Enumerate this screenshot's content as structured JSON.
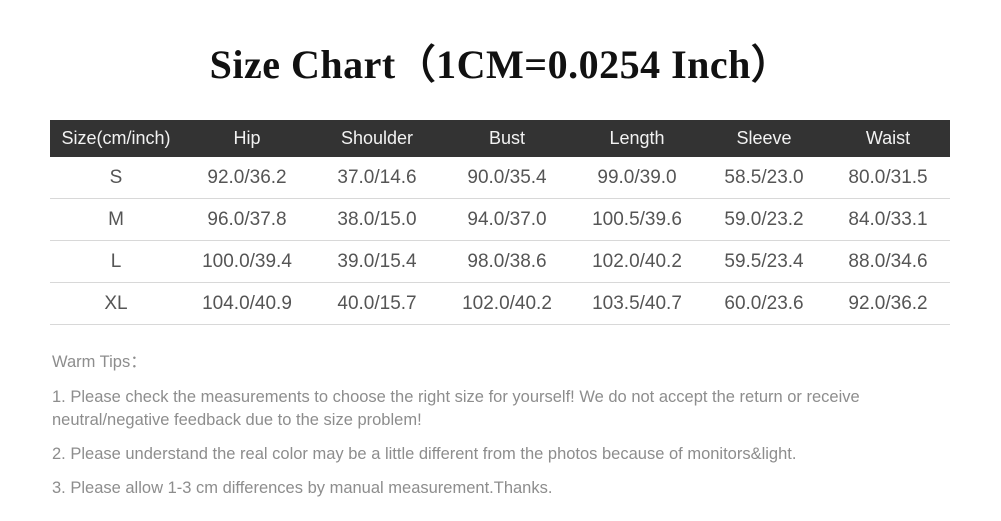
{
  "title": "Size Chart（1CM=0.0254 Inch）",
  "table": {
    "headers": {
      "size": "Size(cm/inch)",
      "hip": "Hip",
      "shoulder": "Shoulder",
      "bust": "Bust",
      "length": "Length",
      "sleeve": "Sleeve",
      "waist": "Waist"
    },
    "rows": [
      {
        "size": "S",
        "hip": "92.0/36.2",
        "shoulder": "37.0/14.6",
        "bust": "90.0/35.4",
        "length": "99.0/39.0",
        "sleeve": "58.5/23.0",
        "waist": "80.0/31.5"
      },
      {
        "size": "M",
        "hip": "96.0/37.8",
        "shoulder": "38.0/15.0",
        "bust": "94.0/37.0",
        "length": "100.5/39.6",
        "sleeve": "59.0/23.2",
        "waist": "84.0/33.1"
      },
      {
        "size": "L",
        "hip": "100.0/39.4",
        "shoulder": "39.0/15.4",
        "bust": "98.0/38.6",
        "length": "102.0/40.2",
        "sleeve": "59.5/23.4",
        "waist": "88.0/34.6"
      },
      {
        "size": "XL",
        "hip": "104.0/40.9",
        "shoulder": "40.0/15.7",
        "bust": "102.0/40.2",
        "length": "103.5/40.7",
        "sleeve": "60.0/23.6",
        "waist": "92.0/36.2"
      }
    ]
  },
  "tips": {
    "heading": "Warm Tips：",
    "items": [
      "1. Please check the measurements to choose the right size for yourself! We do not accept the return or receive neutral/negative feedback due to the size problem!",
      "2. Please understand the real color may be a little different from the photos because of monitors&light.",
      "3. Please allow 1-3 cm differences by manual measurement.Thanks."
    ]
  },
  "colors": {
    "header_background": "#333333",
    "header_text": "#f2f2f2",
    "body_text": "#555555",
    "tips_text": "#8d8d8d",
    "rule": "#d8d8d8",
    "page_background": "#ffffff"
  }
}
